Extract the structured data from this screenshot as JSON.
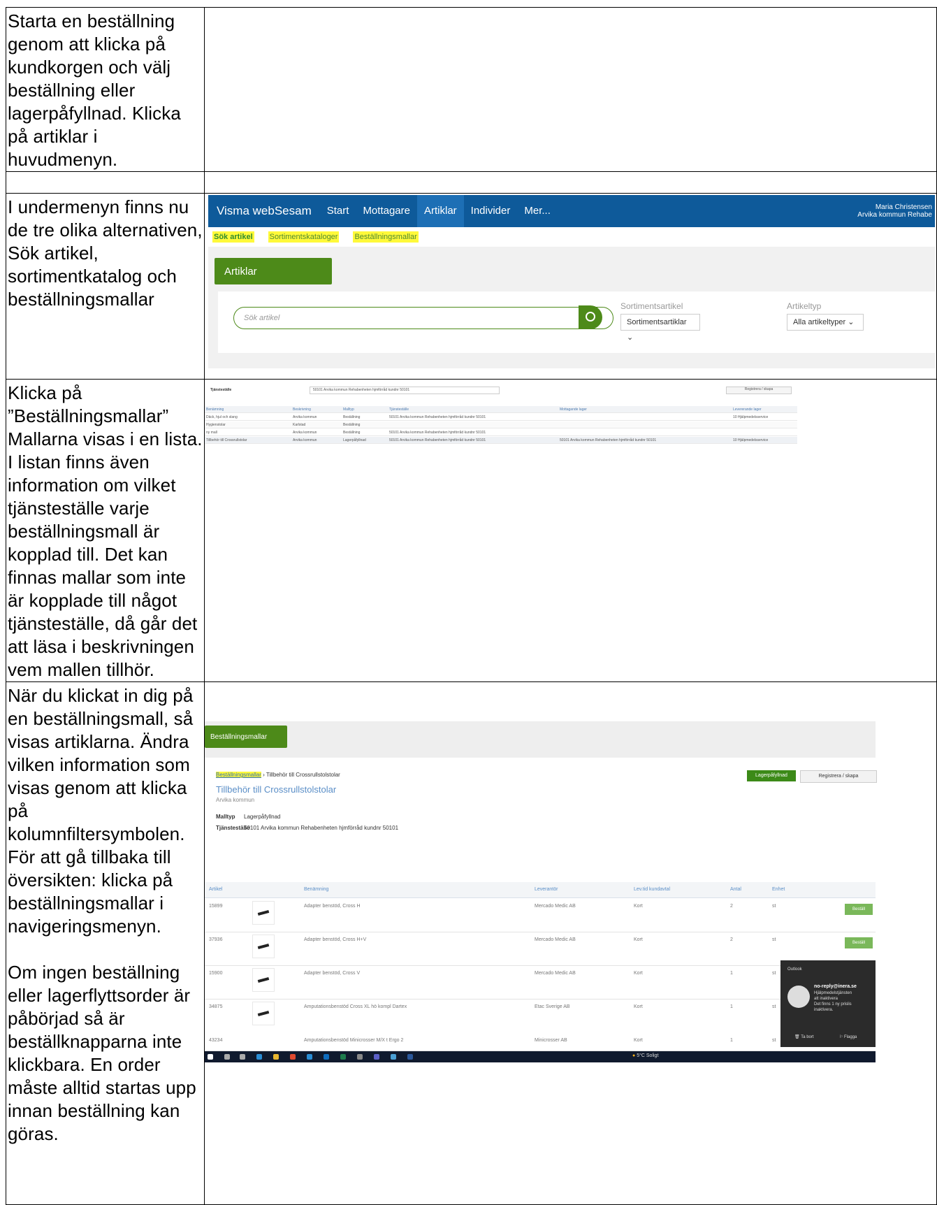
{
  "rows": [
    {
      "text": "Starta en beställning genom att klicka på kundkorgen och välj beställning eller lagerpåfyllnad. Klicka på artiklar i huvudmenyn."
    },
    {
      "text": ""
    },
    {
      "text": "I undermenyn finns nu de tre olika alternativen, Sök artikel, sortimentkatalog och beställningsmallar"
    },
    {
      "text": "Klicka på ”Beställningsmallar” Mallarna visas i en lista. I listan finns även information om vilket tjänsteställe varje beställningsmall är kopplad till. Det kan finnas mallar som inte är kopplade till något tjänsteställe, då går det att läsa i beskrivningen vem mallen tillhör."
    },
    {
      "text_a": "När du klickat in dig på en beställningsmall, så visas artiklarna.  Ändra vilken information som visas genom att klicka på kolumnfiltersymbolen. För att gå tillbaka till översikten: klicka på beställningsmallar i navigeringsmenyn.",
      "text_b": "Om ingen beställning eller lagerflyttsorder är påbörjad så är beställknapparna inte klickbara. En order måste alltid startas upp innan beställning kan göras."
    }
  ],
  "artiklar_screen": {
    "app_name": "Visma webSesam",
    "menu": [
      "Start",
      "Mottagare",
      "Artiklar",
      "Individer",
      "Mer..."
    ],
    "user_name": "Maria Christensen",
    "user_org": "Arvika kommun Rehabe",
    "submenu": [
      "Sök artikel",
      "Sortimentskataloger",
      "Beställningsmallar"
    ],
    "section_button": "Artiklar",
    "search_placeholder": "Sök artikel",
    "filter1_label": "Sortimentsartikel",
    "filter1_value": "Sortimentsartiklar",
    "filter2_label": "Artikeltyp",
    "filter2_value": "Alla artikeltyper"
  },
  "list_screen": {
    "tjanstestalle_label": "Tjänsteställe",
    "tjanstestalle_value": "50101 Arvika kommun Rehabenheten hjmförråd kundnr 50101",
    "register_button": "Registrera / skapa",
    "headers": [
      "Benämning",
      "Beskrivning",
      "Malltyp",
      "Tjänsteställe",
      "Mottagande lager",
      "Levererande lager"
    ],
    "rows": [
      [
        "Däck, hjul och slang",
        "Arvika kommun",
        "Beställning",
        "50101 Arvika kommun Rehabenheten hjmförråd kundnr 50101",
        "",
        "10 Hjälpmedelsservice"
      ],
      [
        "Hygienstolar",
        "Karlstad",
        "Beställning",
        "",
        "",
        ""
      ],
      [
        "ny mall",
        "Arvika kommun",
        "Beställning",
        "50101 Arvika kommun Rehabenheten hjmförråd kundnr 50101",
        "",
        ""
      ],
      [
        "Tillbehör till Crossrullstolar",
        "Arvika kommun",
        "Lagerpåfyllnad",
        "50101 Arvika kommun Rehabenheten hjmförråd kundnr 50101",
        "50101 Arvika kommun Rehabenheten hjmförråd kundnr 50101",
        "10 Hjälpmedelsservice"
      ]
    ]
  },
  "mall_screen": {
    "section_button": "Beställningsmallar",
    "crumb_link": "Beställningsmallar",
    "crumb_current": "Tillbehör till Crossrullstolstolar",
    "title": "Tillbehör till Crossrullstolstolar",
    "subtitle": "Arvika kommun",
    "malltyp_label": "Malltyp",
    "malltyp_value": "Lagerpåfyllnad",
    "tjanst_label": "Tjänsteställe",
    "tjanst_value": "50101 Arvika kommun Rehabenheten hjmförråd kundnr 50101",
    "lager_button": "Lagerpåfyllnad",
    "register_button": "Registrera / skapa",
    "headers": [
      "Artikel",
      "Benämning",
      "Leverantör",
      "Lev.tid kundavtal",
      "Antal",
      "Enhet"
    ],
    "order_button": "Beställ",
    "rows": [
      {
        "artikel": "15899",
        "namn": "Adapter benstöd, Cross H",
        "lev": "Mercado Medic AB",
        "tid": "Kort",
        "antal": "2",
        "enhet": "st"
      },
      {
        "artikel": "37936",
        "namn": "Adapter benstöd, Cross H+V",
        "lev": "Mercado Medic AB",
        "tid": "Kort",
        "antal": "2",
        "enhet": "st"
      },
      {
        "artikel": "15900",
        "namn": "Adapter benstöd, Cross V",
        "lev": "Mercado Medic AB",
        "tid": "Kort",
        "antal": "1",
        "enhet": "st"
      },
      {
        "artikel": "34875",
        "namn": "Amputationsbenstöd Cross XL hö kompl Dartex",
        "lev": "Etac Sverige AB",
        "tid": "Kort",
        "antal": "1",
        "enhet": "st"
      },
      {
        "artikel": "43234",
        "namn": "Amputationsbenstöd Minicrosser M/X t Ergo 2",
        "lev": "Minicrosser AB",
        "tid": "Kort",
        "antal": "1",
        "enhet": "st"
      }
    ],
    "toast": {
      "app": "Outlook",
      "sender": "no-reply@inera.se",
      "line1": "Hjälpmedelstjänsten",
      "line2": "att inaktivera",
      "line3": "Det finns 1 ny prislis",
      "line4": "inaktivera.",
      "action1": "Ta bort",
      "action2": "Flagga"
    },
    "weather": "5°C Soligt"
  }
}
